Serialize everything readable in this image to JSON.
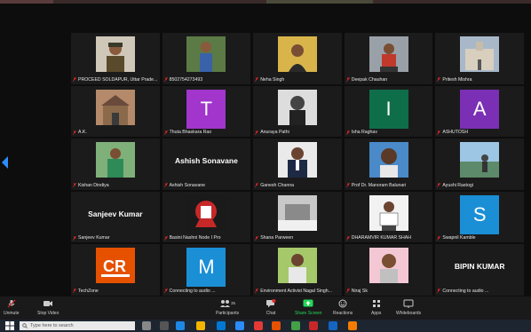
{
  "participants": [
    {
      "name": "PROCEED SOLDAPUR, Uttar Prade...",
      "type": "photo",
      "photo": "officer"
    },
    {
      "name": "8502754273493",
      "type": "photo",
      "photo": "man-outdoor"
    },
    {
      "name": "Neha Singh",
      "type": "photo",
      "photo": "woman-yellow"
    },
    {
      "name": "Deepak Chauhan",
      "type": "photo",
      "photo": "man-sitting"
    },
    {
      "name": "Pritesh Mishra",
      "type": "photo",
      "photo": "palace"
    },
    {
      "name": "A.K.",
      "type": "photo",
      "photo": "house"
    },
    {
      "name": "Thuta Bhaskara Rao",
      "type": "letter",
      "letter": "T",
      "color": "#a135cc"
    },
    {
      "name": "Anuraya Pathi",
      "type": "photo",
      "photo": "bw-portrait"
    },
    {
      "name": "Isha Raghav",
      "type": "letter",
      "letter": "I",
      "color": "#0f6e4a"
    },
    {
      "name": "ASHUTOSH",
      "type": "letter",
      "letter": "A",
      "color": "#7a2fb5"
    },
    {
      "name": "Kishan Dindiya",
      "type": "photo",
      "photo": "man-green"
    },
    {
      "name": "Ashish Sonavane",
      "type": "text",
      "display": "Ashish Sonavane"
    },
    {
      "name": "Ganesh Channa",
      "type": "photo",
      "photo": "man-suit"
    },
    {
      "name": "Prof Dr. Manoram Balunari",
      "type": "photo",
      "photo": "man-smile"
    },
    {
      "name": "Ayushi Rastogi",
      "type": "photo",
      "photo": "lake"
    },
    {
      "name": "Sanjeev Kumar",
      "type": "text",
      "display": "Sanjeev Kumar"
    },
    {
      "name": "Basini Nashni Node I Pro",
      "type": "photo",
      "photo": "red-art"
    },
    {
      "name": "Shana Parween",
      "type": "photo",
      "photo": "snow"
    },
    {
      "name": "DHARAMVIR KUMAR SHAH",
      "type": "photo",
      "photo": "man-board"
    },
    {
      "name": "Swapnil Kamble",
      "type": "letter",
      "letter": "S",
      "color": "#1a8fd6"
    },
    {
      "name": "TechZone",
      "type": "photo",
      "photo": "cr-logo"
    },
    {
      "name": "Connecting to audio ...",
      "type": "letter",
      "letter": "M",
      "color": "#1a8fd6"
    },
    {
      "name": "Environment Activist Nagal Singh...",
      "type": "photo",
      "photo": "man-field"
    },
    {
      "name": "Niraj Sk",
      "type": "photo",
      "photo": "man-young"
    },
    {
      "name": "Connecting to audio ...",
      "type": "text",
      "display": "BIPIN KUMAR"
    }
  ],
  "toolbar": {
    "unmute": "Unmute",
    "stop_video": "Stop Video",
    "participants": "Participants",
    "participants_count": "35",
    "chat": "Chat",
    "share_screen": "Share Screen",
    "reactions": "Reactions",
    "apps": "Apps",
    "whiteboards": "Whiteboards"
  },
  "taskbar": {
    "search_placeholder": "Type here to search"
  },
  "colors": {
    "accent": "#2d8cff",
    "share": "#23d959",
    "mute_red": "#e02828"
  }
}
